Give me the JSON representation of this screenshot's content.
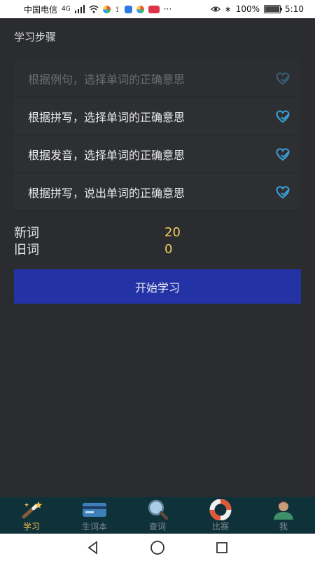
{
  "status_bar": {
    "carrier": "中国电信",
    "network": "4G",
    "battery": "100%",
    "battery_level": 1.0,
    "time": "5:10"
  },
  "section_title": "学习步骤",
  "steps": [
    {
      "label": "根据例句，选择单词的正确意思",
      "enabled": false
    },
    {
      "label": "根据拼写，选择单词的正确意思",
      "enabled": true
    },
    {
      "label": "根据发音，选择单词的正确意思",
      "enabled": true
    },
    {
      "label": "根据拼写，说出单词的正确意思",
      "enabled": true
    }
  ],
  "counters": {
    "new_label": "新词",
    "new_value": "20",
    "old_label": "旧词",
    "old_value": "0"
  },
  "start_button_label": "开始学习",
  "bottom_nav": [
    {
      "label": "学习",
      "icon": "magic-wand-icon",
      "active": true
    },
    {
      "label": "生词本",
      "icon": "card-icon",
      "active": false
    },
    {
      "label": "查词",
      "icon": "magnifier-icon",
      "active": false
    },
    {
      "label": "比赛",
      "icon": "life-ring-icon",
      "active": false
    },
    {
      "label": "我",
      "icon": "user-icon",
      "active": false
    }
  ],
  "colors": {
    "accent_yellow": "#f2cf5b",
    "primary_button": "#2333a6",
    "heart_blue": "#3aa0d8",
    "nav_background": "#0f3139"
  }
}
